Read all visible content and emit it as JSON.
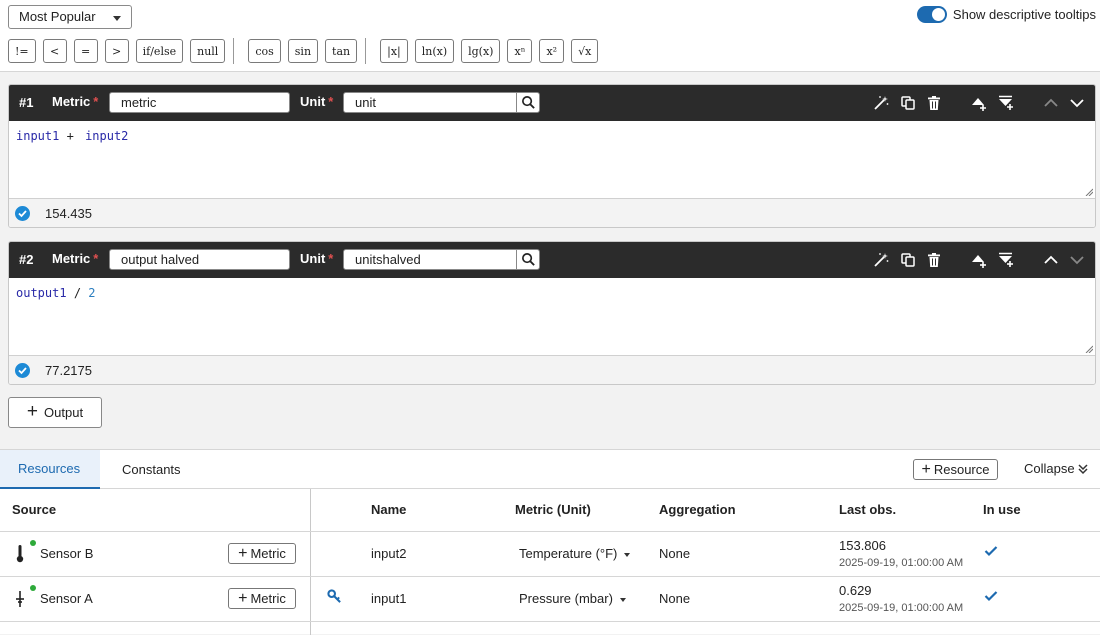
{
  "toolbar": {
    "preset_select": "Most Popular",
    "tooltip_toggle_label": "Show descriptive tooltips",
    "operators_group1": [
      "!=",
      "<",
      "=",
      ">",
      "if/else",
      "null"
    ],
    "operators_group2": [
      "cos",
      "sin",
      "tan"
    ],
    "operators_group3": [
      "|x|",
      "ln(x)",
      "lg(x)",
      "xⁿ",
      "x²",
      "√x"
    ]
  },
  "outputs": [
    {
      "number": "#1",
      "metric_label": "Metric",
      "metric_value": "metric",
      "unit_label": "Unit",
      "unit_value": "unit",
      "expr": {
        "a": "input1",
        "op": "+",
        "b": "input2"
      },
      "result": "154.435"
    },
    {
      "number": "#2",
      "metric_label": "Metric",
      "metric_value": "output halved",
      "unit_label": "Unit",
      "unit_value": "unitshalved",
      "expr": {
        "a": "output1",
        "op": "/",
        "b": "2"
      },
      "result": "77.2175"
    }
  ],
  "output_button": "Output",
  "tabs": {
    "resources": "Resources",
    "constants": "Constants"
  },
  "resource_button": "Resource",
  "collapse_label": "Collapse",
  "table": {
    "headers": {
      "source": "Source",
      "name": "Name",
      "metric_unit": "Metric (Unit)",
      "aggregation": "Aggregation",
      "last_obs": "Last obs.",
      "in_use": "In use"
    },
    "metric_button": "Metric",
    "rows": [
      {
        "source": "Sensor B",
        "name": "input2",
        "metric_unit": "Temperature (°F)",
        "aggregation": "None",
        "last_value": "153.806",
        "last_time": "2025-09-19, 01:00:00 AM"
      },
      {
        "source": "Sensor A",
        "name": "input1",
        "metric_unit": "Pressure (mbar)",
        "aggregation": "None",
        "last_value": "0.629",
        "last_time": "2025-09-19, 01:00:00 AM"
      }
    ]
  },
  "colors": {
    "accent": "#1d6ab0",
    "header_dark": "#2b2b2b",
    "status_ok": "#1d8ad6",
    "online": "#2eaa3a",
    "required": "#e05050"
  }
}
